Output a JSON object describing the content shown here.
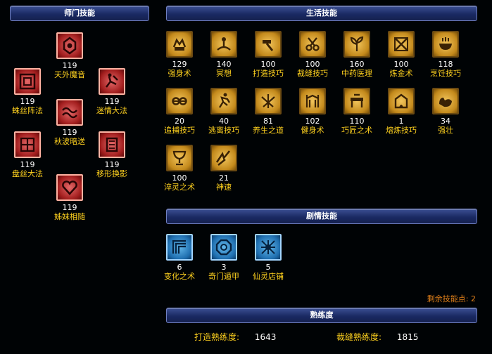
{
  "sections": {
    "sect": "师门技能",
    "life": "生活技能",
    "story": "剧情技能",
    "proficiency": "熟练度"
  },
  "sect_skills": [
    {
      "level": "119",
      "name": "天外魔音",
      "icon": "bell-rune-icon"
    },
    {
      "level": "119",
      "name": "蛛丝阵法",
      "icon": "web-square-icon"
    },
    {
      "level": "119",
      "name": "迷情大法",
      "icon": "dancer-icon"
    },
    {
      "level": "119",
      "name": "秋波暗送",
      "icon": "wave-eye-icon"
    },
    {
      "level": "119",
      "name": "盘丝大法",
      "icon": "silk-grid-icon"
    },
    {
      "level": "119",
      "name": "移形换影",
      "icon": "shadow-shift-icon"
    },
    {
      "level": "119",
      "name": "姊妹相随",
      "icon": "heart-icon"
    }
  ],
  "life_skills": [
    {
      "level": "129",
      "name": "强身术",
      "icon": "fist-icon"
    },
    {
      "level": "140",
      "name": "冥想",
      "icon": "meditation-icon"
    },
    {
      "level": "100",
      "name": "打造技巧",
      "icon": "hammer-icon"
    },
    {
      "level": "100",
      "name": "裁缝技巧",
      "icon": "scissors-icon"
    },
    {
      "level": "160",
      "name": "中药医理",
      "icon": "herb-icon"
    },
    {
      "level": "100",
      "name": "炼金术",
      "icon": "alchemy-icon"
    },
    {
      "level": "118",
      "name": "烹饪技巧",
      "icon": "cooking-pot-icon"
    },
    {
      "level": "20",
      "name": "追捕技巧",
      "icon": "shackle-icon"
    },
    {
      "level": "40",
      "name": "逃离技巧",
      "icon": "running-icon"
    },
    {
      "level": "81",
      "name": "养生之道",
      "icon": "lotus-icon"
    },
    {
      "level": "102",
      "name": "健身术",
      "icon": "gym-icon"
    },
    {
      "level": "110",
      "name": "巧匠之术",
      "icon": "workbench-icon"
    },
    {
      "level": "1",
      "name": "熔炼技巧",
      "icon": "furnace-icon"
    },
    {
      "level": "34",
      "name": "强壮",
      "icon": "muscle-icon"
    },
    {
      "level": "100",
      "name": "淬灵之术",
      "icon": "chalice-icon"
    },
    {
      "level": "21",
      "name": "神速",
      "icon": "speed-icon"
    }
  ],
  "story_skills": [
    {
      "level": "6",
      "name": "变化之术",
      "icon": "transform-icon"
    },
    {
      "level": "3",
      "name": "奇门遁甲",
      "icon": "octagon-icon"
    },
    {
      "level": "5",
      "name": "仙灵店铺",
      "icon": "shop-icon"
    }
  ],
  "remaining_points": "剩余技能点: 2",
  "proficiency": {
    "forge_label": "打造熟练度:",
    "forge_value": "1643",
    "tailor_label": "裁缝熟练度:",
    "tailor_value": "1815"
  }
}
